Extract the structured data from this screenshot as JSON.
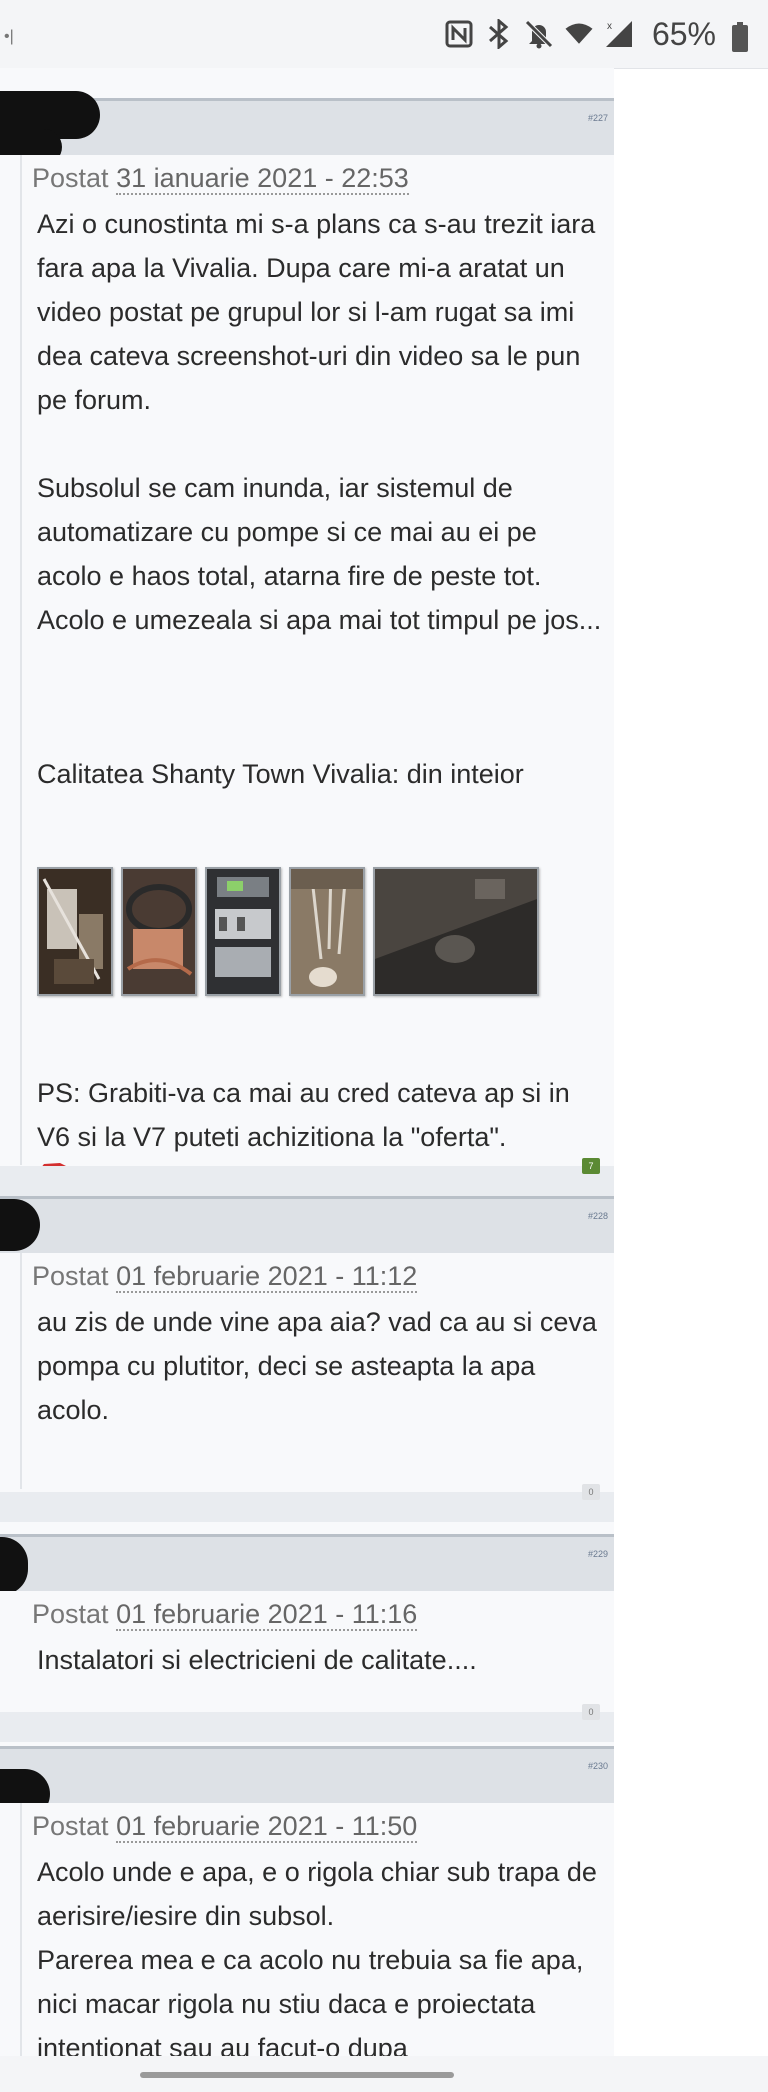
{
  "status_bar": {
    "battery_percent": "65%",
    "icons": [
      "nfc-icon",
      "bluetooth-icon",
      "notifications-off-icon",
      "wifi-icon",
      "signal-icon",
      "battery-icon"
    ]
  },
  "posts": [
    {
      "number": "#227",
      "meta_prefix": "Postat",
      "date": "31 ianuarie 2021 - 22:53",
      "paragraphs": [
        "Azi o cunostinta mi s-a plans ca s-au trezit iara fara apa la Vivalia. Dupa care mi-a aratat un video postat pe grupul lor si l-am rugat sa imi dea cateva screenshot-uri din video sa le pun pe forum.",
        "Subsolul se cam inunda, iar sistemul de automatizare cu pompe si ce mai au ei pe acolo e haos total, atarna fire de peste tot. Acolo e umezeala si apa mai tot timpul pe jos...",
        "Calitatea Shanty Town Vivalia: din inteior"
      ],
      "closing": "PS: Grabiti-va ca mai au cred cateva ap si in V6 si la V7 puteti achizitiona la \"oferta\".",
      "reputation": "7"
    },
    {
      "number": "#228",
      "meta_prefix": "Postat",
      "date": "01 februarie 2021 - 11:12",
      "text": "au zis de unde vine apa aia? vad ca au si ceva pompa cu plutitor, deci se asteapta la apa acolo.",
      "reputation": "0"
    },
    {
      "number": "#229",
      "meta_prefix": "Postat",
      "date": "01 februarie 2021 - 11:16",
      "text": "Instalatori si electricieni de calitate....",
      "reputation": "0"
    },
    {
      "number": "#230",
      "meta_prefix": "Postat",
      "date": "01 februarie 2021 - 11:50",
      "text": "Acolo unde e apa, e o rigola chiar sub trapa de aerisire/iesire din subsol.\nParerea mea e ca acolo nu trebuia sa fie apa, nici macar rigola nu stiu daca e proiectata intentionat sau au facut-o dupa"
    }
  ],
  "colors": {
    "header_bg": "#dde1e6",
    "post_bg": "#f8f9fb",
    "rep_positive": "#5b8a33"
  }
}
